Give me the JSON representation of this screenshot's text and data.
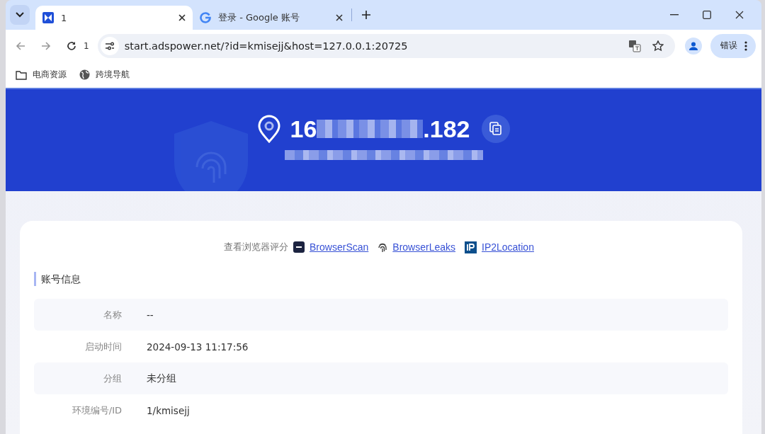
{
  "tabs": [
    {
      "title": "1",
      "selected": true
    },
    {
      "title": "登录 - Google 账号",
      "selected": false
    }
  ],
  "toolbar": {
    "reload_count": "1",
    "url": "start.adspower.net/?id=kmisejj&host=127.0.0.1:20725",
    "profile_button": "错误"
  },
  "bookmarks": [
    {
      "label": "电商资源"
    },
    {
      "label": "跨境导航"
    }
  ],
  "header": {
    "ip_start": "16",
    "ip_end": ".182"
  },
  "score_bar": {
    "label": "查看浏览器评分",
    "links": [
      {
        "label": "BrowserScan"
      },
      {
        "label": "BrowserLeaks"
      },
      {
        "label": "IP2Location"
      }
    ]
  },
  "section_title": "账号信息",
  "rows": [
    {
      "label": "名称",
      "value": "--"
    },
    {
      "label": "启动时间",
      "value": "2024-09-13 11:17:56"
    },
    {
      "label": "分组",
      "value": "未分组"
    },
    {
      "label": "环境编号/ID",
      "value": "1/kmisejj"
    }
  ]
}
